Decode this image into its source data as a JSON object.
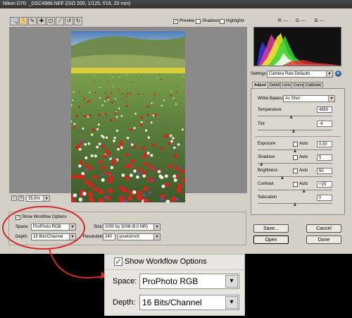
{
  "window": {
    "title": "Nikon D70:  _DSC4986.NEF  (ISO 200, 1/125, f/16, 20 mm)"
  },
  "toolbar": {
    "tools": [
      {
        "name": "zoom-tool",
        "glyph": "🔍"
      },
      {
        "name": "hand-tool",
        "glyph": "✋"
      },
      {
        "name": "white-balance-tool",
        "glyph": "✎"
      },
      {
        "name": "color-sampler-tool",
        "glyph": "✚"
      },
      {
        "name": "crop-tool",
        "glyph": "⊡"
      },
      {
        "name": "straighten-tool",
        "glyph": "⟋"
      },
      {
        "name": "rotate-left-tool",
        "glyph": "↺"
      },
      {
        "name": "rotate-right-tool",
        "glyph": "↻"
      }
    ],
    "preview_label": "Preview",
    "preview_checked": true,
    "shadows_label": "Shadows",
    "shadows_checked": false,
    "highlights_label": "Highlights",
    "highlights_checked": false
  },
  "rgb_readout": {
    "r_label": "R:",
    "r_value": "---",
    "g_label": "G:",
    "g_value": "---",
    "b_label": "B:",
    "b_value": "---"
  },
  "settings": {
    "label": "Settings:",
    "value": "Camera Raw Defaults"
  },
  "tabs": [
    "Adjust",
    "Detail",
    "Lens",
    "Curve",
    "Calibrate"
  ],
  "active_tab": "Adjust",
  "white_balance": {
    "label": "White Balance:",
    "value": "As Shot"
  },
  "temperature": {
    "label": "Temperature",
    "value": "4850",
    "level": 0.45
  },
  "tint": {
    "label": "Tint",
    "value": "-4",
    "level": 0.48
  },
  "adjustments": [
    {
      "key": "exposure",
      "label": "Exposure",
      "auto_label": "Auto",
      "value": "0,00",
      "level": 0.5
    },
    {
      "key": "shadows",
      "label": "Shadows",
      "auto_label": "Auto",
      "value": "5",
      "level": 0.05
    },
    {
      "key": "brightness",
      "label": "Brightness",
      "auto_label": "Auto",
      "value": "50",
      "level": 0.33
    },
    {
      "key": "contrast",
      "label": "Contrast",
      "auto_label": "Auto",
      "value": "+25",
      "level": 0.62
    },
    {
      "key": "saturation",
      "label": "Saturation",
      "auto_label": "",
      "value": "0",
      "level": 0.5
    }
  ],
  "zoom": {
    "minus": "-",
    "plus": "+",
    "value": "35,6%"
  },
  "workflow": {
    "show_label": "Show Workflow Options",
    "space_label": "Space:",
    "space_value": "ProPhoto RGB",
    "depth_label": "Depth:",
    "depth_value": "16 Bits/Channel",
    "size_label": "Size:",
    "size_value": "2000 by 3008  (6,0 MP)",
    "resolution_label": "Resolution:",
    "resolution_value": "240",
    "resolution_unit": "pixels/inch"
  },
  "buttons": {
    "save": "Save...",
    "cancel": "Cancel",
    "open": "Open",
    "done": "Done"
  },
  "colors": {
    "annotation": "#d42a2a",
    "accent": "#3a6ea5",
    "check": "#1a7a1a"
  }
}
